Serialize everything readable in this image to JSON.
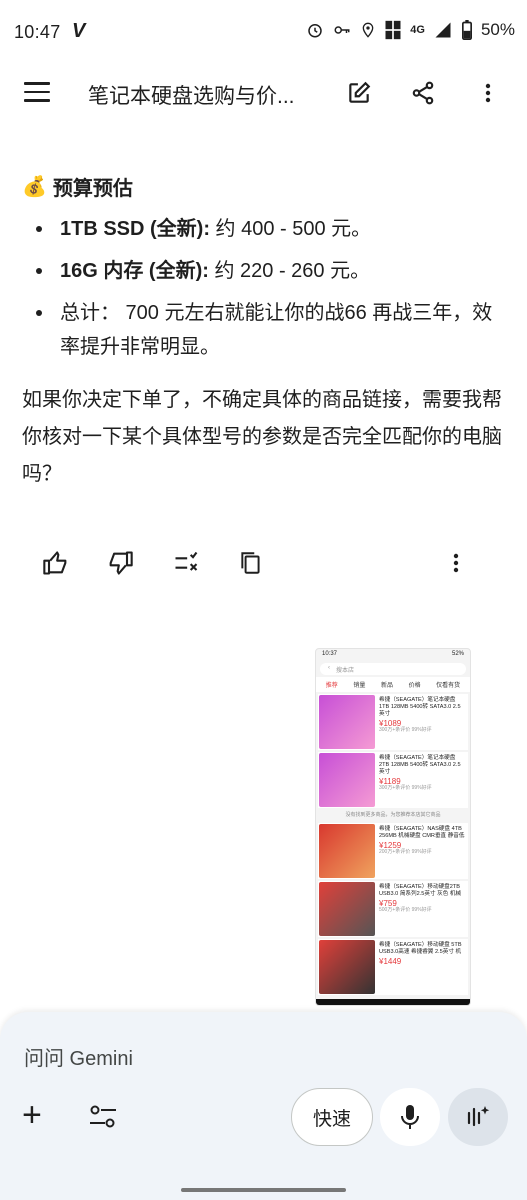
{
  "status": {
    "time": "10:47",
    "network": "4G",
    "battery": "50%"
  },
  "appbar": {
    "title": "笔记本硬盘选购与价..."
  },
  "content": {
    "section_title": "预算预估",
    "bullets": [
      {
        "bold": "1TB SSD (全新):",
        "text": " 约 400 - 500 元。"
      },
      {
        "bold": "16G 内存 (全新):",
        "text": " 约 220 - 260 元。"
      },
      {
        "bold": "",
        "text": "总计： 700 元左右就能让你的战66 再战三年，效率提升非常明显。"
      }
    ],
    "paragraph": "如果你决定下单了，不确定具体的商品链接，需要我帮你核对一下某个具体型号的参数是否完全匹配你的电脑吗？"
  },
  "thumbnail": {
    "time": "10:37",
    "battery": "52%",
    "search_placeholder": "搜本店",
    "tabs": [
      "推荐",
      "销量",
      "新品",
      "价格",
      "仅看有货"
    ],
    "items": [
      {
        "title": "希捷（SEAGATE）笔记本硬盘1TB 128MB 5400转 SATA3.0 2.5英寸",
        "price": "¥1089",
        "meta": "300万+条评价 99%好评"
      },
      {
        "title": "希捷（SEAGATE）笔记本硬盘2TB 128MB 5400转 SATA3.0 2.5英寸",
        "price": "¥1189",
        "meta": "300万+条评价 99%好评"
      },
      {
        "title": "希捷（SEAGATE）NAS硬盘 4TB 256MB 机械硬盘 CMR垂直 静音低",
        "price": "¥1259",
        "meta": "200万+条评价 99%好评"
      },
      {
        "title": "希捷（SEAGATE）移动硬盘2TB USB3.0 简系列2.5英寸 灰色 机械",
        "price": "¥759",
        "meta": "500万+条评价 99%好评"
      },
      {
        "title": "希捷（SEAGATE）移动硬盘 5TB USB3.0高速 希捷睿翼 2.5英寸 机",
        "price": "¥1449",
        "meta": ""
      }
    ],
    "note": "没有找到更多商品，为您推荐本店其它商品"
  },
  "composer": {
    "placeholder": "问问 Gemini",
    "fast_label": "快速"
  },
  "colors": {
    "sheet_bg": "#f0f4f9",
    "live_bg": "#dde3ea",
    "price_red": "#e4393c"
  }
}
